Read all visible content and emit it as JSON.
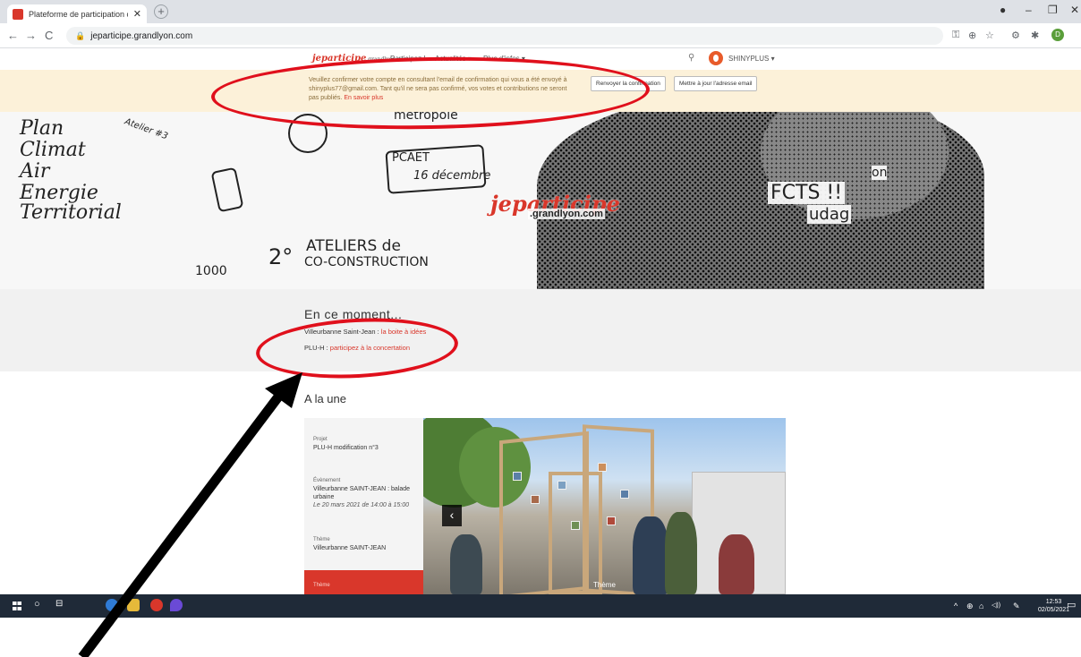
{
  "browser": {
    "tab_title": "Plateforme de participation citoy",
    "tab_close": "✕",
    "new_tab": "+",
    "url": "jeparticipe.grandlyon.com",
    "window_controls": [
      "●",
      "–",
      "❐",
      "✕"
    ],
    "nav": {
      "back": "←",
      "forward": "→",
      "reload": "C"
    },
    "toolbar_icons": [
      "⚿",
      "⊕",
      "☆",
      "⚙",
      "✱"
    ],
    "profile_initial": "D"
  },
  "site": {
    "logo_main": "jeparticipe",
    "logo_sub": ".grandlyon.com",
    "nav": [
      "Participez !",
      "Actualités ▾",
      "Plus d'infos ▾"
    ],
    "search_icon": "⚲",
    "username": "SHINYPLUS ▾"
  },
  "banner": {
    "text": "Veuillez confirmer votre compte en consultant l'email de confirmation qui vous a été envoyé à shinyplus77@gmail.com. Tant qu'il ne sera pas confirmé, vos votes et contributions ne seront pas publiés.",
    "link": "En savoir plus",
    "buttons": [
      "Renvoyer la confirmation",
      "Mettre à jour l'adresse email"
    ]
  },
  "hero": {
    "words": [
      "Plan",
      "Climat",
      "Air",
      "Energie",
      "Territorial"
    ],
    "doodles": [
      "Atelier #3",
      "métropole",
      "PCAET",
      "16 décembre",
      "ATELIERS de",
      "CO-CONSTRUCTION",
      "2°",
      "1000",
      "FCTS !!",
      "udag",
      "on"
    ],
    "logo_main": "jeparticipe",
    "logo_sub": ".grandlyon.com"
  },
  "moment": {
    "title": "En ce moment...",
    "items": [
      {
        "label": "Villeurbanne Saint-Jean",
        "sep": " : ",
        "link": "la boite à idées"
      },
      {
        "label": "PLU-H",
        "sep": " : ",
        "link": "participez à la concertation"
      }
    ]
  },
  "une": {
    "title": "A la une",
    "blocks": [
      {
        "label": "Projet",
        "value": "PLU-H modification n°3"
      },
      {
        "label": "Évènement",
        "value": "Villeurbanne SAINT-JEAN : balade urbaine",
        "date": "Le 20 mars 2021 de 14:00 à 15:00"
      },
      {
        "label": "Thème",
        "value": "Villeurbanne SAINT-JEAN"
      }
    ],
    "active_label": "Thème",
    "prev_arrow": "‹",
    "caption": "Thème"
  },
  "taskbar": {
    "tray_icons": [
      "^",
      "⊕",
      "⌂",
      "◁))",
      "✎"
    ],
    "time": "12:53",
    "date": "02/05/2021",
    "notif": "▭"
  },
  "colors": {
    "accent": "#d9372b",
    "banner_bg": "#fcf1d9",
    "annotation": "#e0101c"
  }
}
